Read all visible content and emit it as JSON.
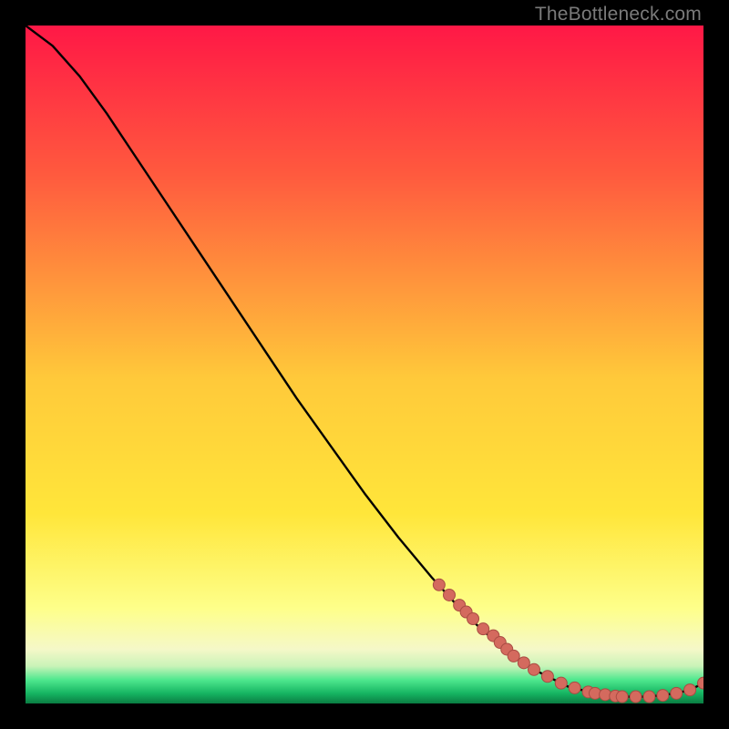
{
  "watermark": "TheBottleneck.com",
  "colors": {
    "gradient_top": "#ff1846",
    "gradient_mid_upper": "#ff7a3a",
    "gradient_mid": "#ffd23a",
    "gradient_mid_lower": "#ffee60",
    "gradient_pale": "#f7f7b8",
    "gradient_green": "#2fe07a",
    "gradient_green_dark": "#0b8f49",
    "curve": "#000000",
    "marker_fill": "#d46a5e",
    "marker_stroke": "#a94c43",
    "frame_bg": "#000000"
  },
  "chart_data": {
    "type": "line",
    "title": "",
    "xlabel": "",
    "ylabel": "",
    "xlim": [
      0,
      100
    ],
    "ylim": [
      0,
      100
    ],
    "series": [
      {
        "name": "curve",
        "x": [
          0,
          4,
          8,
          12,
          16,
          20,
          25,
          30,
          35,
          40,
          45,
          50,
          55,
          60,
          65,
          70,
          75,
          80,
          84,
          88,
          92,
          96,
          98,
          100
        ],
        "y": [
          100,
          97,
          92.5,
          87,
          81,
          75,
          67.5,
          60,
          52.5,
          45,
          38,
          31,
          24.5,
          18.5,
          13,
          8.5,
          5,
          2.5,
          1.5,
          1,
          1,
          1.5,
          2,
          3
        ]
      }
    ],
    "markers": {
      "name": "highlight-points",
      "x": [
        61,
        62.5,
        64,
        65,
        66,
        67.5,
        69,
        70,
        71,
        72,
        73.5,
        75,
        77,
        79,
        81,
        83,
        84,
        85.5,
        87,
        88,
        90,
        92,
        94,
        96,
        98,
        100
      ],
      "y": [
        17.5,
        16,
        14.5,
        13.5,
        12.5,
        11,
        10,
        9,
        8,
        7,
        6,
        5,
        4,
        3,
        2.3,
        1.7,
        1.5,
        1.3,
        1.1,
        1,
        1,
        1,
        1.2,
        1.5,
        2,
        3
      ]
    }
  }
}
